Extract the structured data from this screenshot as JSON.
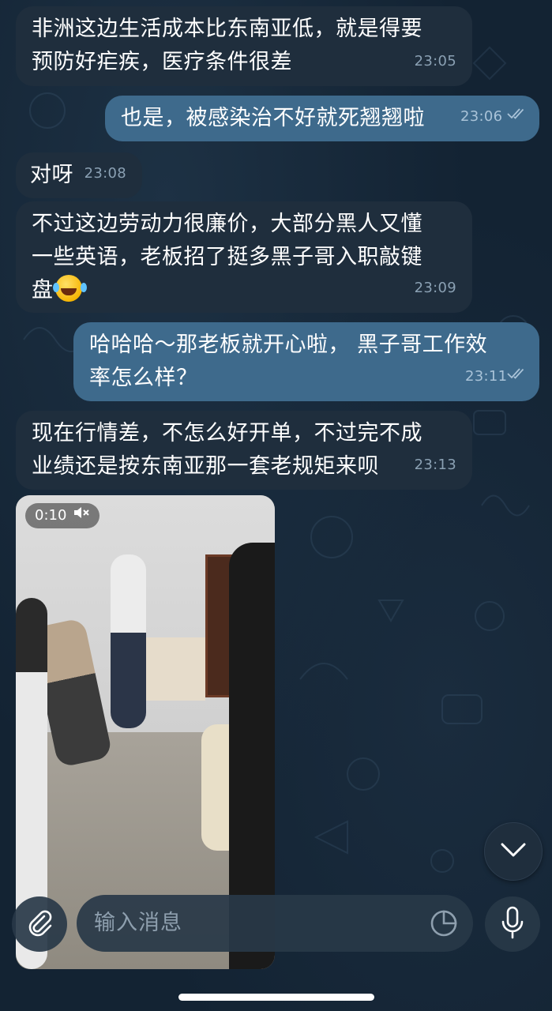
{
  "messages": [
    {
      "dir": "in",
      "text": "非洲这边生活成本比东南亚低，就是得要预防好疟疾，医疗条件很差",
      "lines": [
        "非洲这边生活成本比东南亚低，就是得要",
        "预防好疟疾，医疗条件很差"
      ],
      "time": "23:05"
    },
    {
      "dir": "out",
      "text": "也是，被感染治不好就死翘翘啦",
      "time": "23:06",
      "read": true
    },
    {
      "dir": "in",
      "text": "对呀",
      "time": "23:08"
    },
    {
      "dir": "in",
      "text": "不过这边劳动力很廉价，大部分黑人又懂一些英语，老板招了挺多黑子哥入职敲键盘",
      "lines": [
        "不过这边劳动力很廉价，大部分黑人又懂",
        "一些英语，老板招了挺多黑子哥入职敲键",
        "盘"
      ],
      "emoji": "joy",
      "time": "23:09"
    },
    {
      "dir": "out",
      "text": "哈哈哈～那老板就开心啦， 黑子哥工作效率怎么样？",
      "lines": [
        "哈哈哈～那老板就开心啦， 黑子哥工作效",
        "率怎么样？"
      ],
      "time": "23:11",
      "read": true
    },
    {
      "dir": "in",
      "text": "现在行情差，不怎么好开单，不过完不成业绩还是按东南亚那一套老规矩来呗",
      "lines": [
        "现在行情差，不怎么好开单，不过完不成",
        "业绩还是按东南亚那一套老规矩来呗"
      ],
      "time": "23:13"
    }
  ],
  "video": {
    "duration": "0:10",
    "muted": true,
    "muted_icon": "speaker-muted-icon"
  },
  "composer": {
    "placeholder": "输入消息",
    "attach_icon": "paperclip-icon",
    "sticker_icon": "sticker-icon",
    "mic_icon": "microphone-icon"
  },
  "scroll_down_icon": "chevron-down-icon",
  "colors": {
    "background": "#132333",
    "incoming_bubble": "#1f2e3d",
    "outgoing_bubble": "#3e6a8c",
    "timestamp": "#8aa0b3"
  }
}
